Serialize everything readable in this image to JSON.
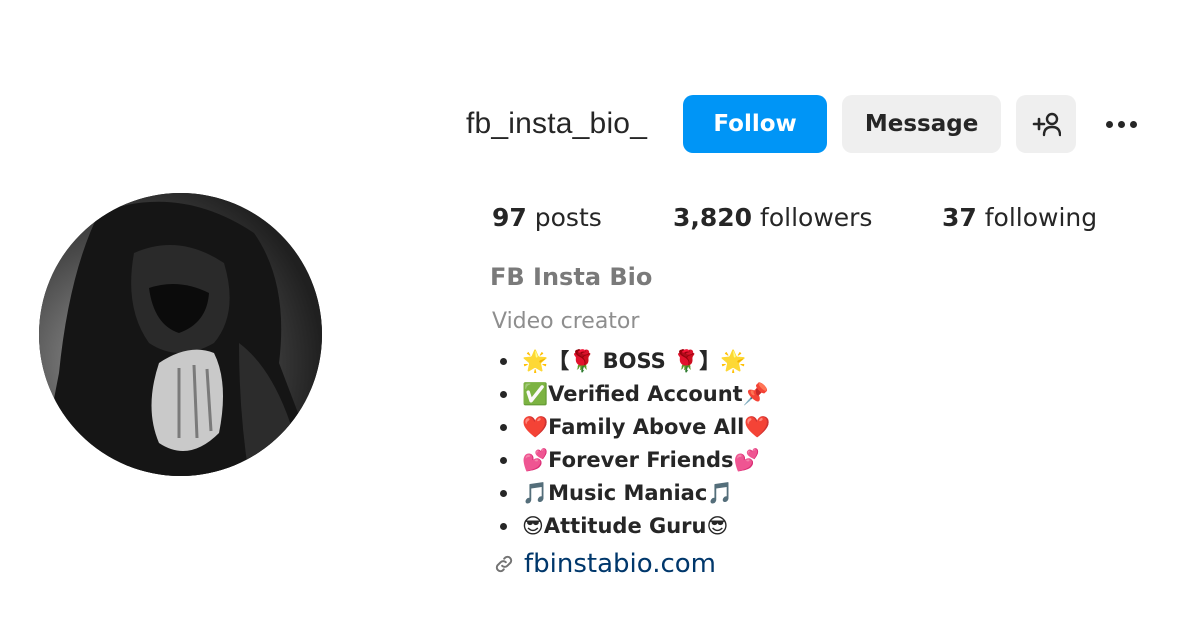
{
  "profile": {
    "username": "fb_insta_bio_",
    "full_name": "FB Insta Bio",
    "category": "Video creator",
    "link": "fbinstabio.com"
  },
  "actions": {
    "follow_label": "Follow",
    "message_label": "Message",
    "follow_color": "#0095f6",
    "add_user_icon": "add-user-icon",
    "more_icon": "more-options-icon"
  },
  "stats": {
    "posts": {
      "value": "97",
      "label": "posts"
    },
    "followers": {
      "value": "3,820",
      "label": "followers"
    },
    "following": {
      "value": "37",
      "label": "following"
    }
  },
  "bio": [
    "🌟【🌹 BOSS 🌹】🌟",
    "✅Verified Account📌",
    "❤️Family Above All❤️",
    "💕Forever Friends💕",
    "🎵Music Maniac🎵",
    "😎Attitude Guru😎"
  ]
}
